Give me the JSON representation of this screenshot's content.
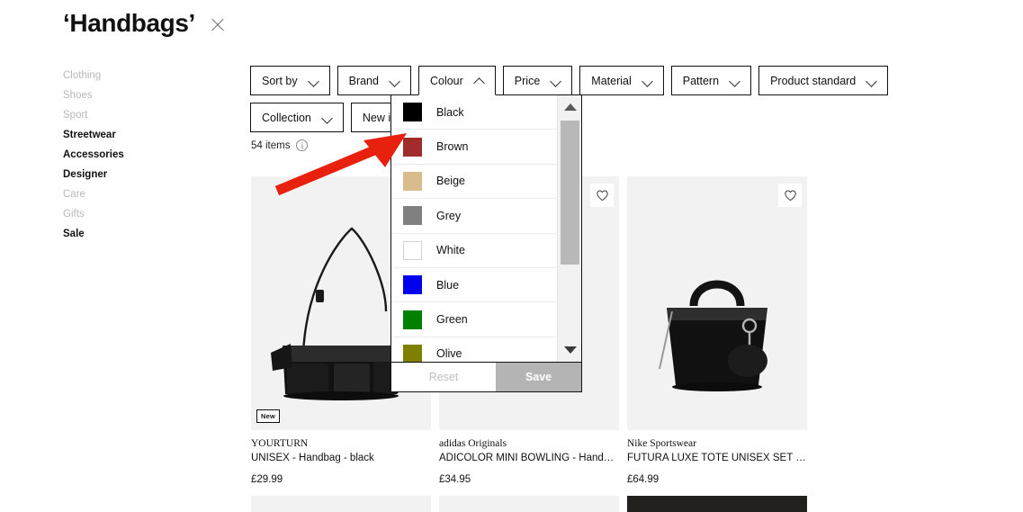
{
  "header": {
    "title": "‘Handbags’",
    "close_label": "close"
  },
  "sidebar": {
    "items": [
      {
        "label": "Clothing",
        "state": "muted"
      },
      {
        "label": "Shoes",
        "state": "muted"
      },
      {
        "label": "Sport",
        "state": "muted"
      },
      {
        "label": "Streetwear",
        "state": "active"
      },
      {
        "label": "Accessories",
        "state": "active"
      },
      {
        "label": "Designer",
        "state": "active"
      },
      {
        "label": "Care",
        "state": "muted"
      },
      {
        "label": "Gifts",
        "state": "muted"
      },
      {
        "label": "Sale",
        "state": "active"
      }
    ]
  },
  "filters": {
    "row1": [
      {
        "label": "Sort by",
        "open": false
      },
      {
        "label": "Brand",
        "open": false
      },
      {
        "label": "Colour",
        "open": true
      },
      {
        "label": "Price",
        "open": false
      },
      {
        "label": "Material",
        "open": false
      },
      {
        "label": "Pattern",
        "open": false
      },
      {
        "label": "Product standard",
        "open": false
      }
    ],
    "row2": [
      {
        "label": "Collection",
        "open": false
      },
      {
        "label": "New in",
        "open": false
      }
    ]
  },
  "results": {
    "count_text": "54 items",
    "info_icon": "info-icon",
    "info_glyph": "i"
  },
  "colour_dropdown": {
    "options": [
      {
        "label": "Black",
        "swatch": "#000000",
        "bordered": false
      },
      {
        "label": "Brown",
        "swatch": "#a02c2c",
        "bordered": false
      },
      {
        "label": "Beige",
        "swatch": "#d9bc8c",
        "bordered": false
      },
      {
        "label": "Grey",
        "swatch": "#808080",
        "bordered": false
      },
      {
        "label": "White",
        "swatch": "#ffffff",
        "bordered": true
      },
      {
        "label": "Blue",
        "swatch": "#0000ee",
        "bordered": false
      },
      {
        "label": "Green",
        "swatch": "#008000",
        "bordered": false
      },
      {
        "label": "Olive",
        "swatch": "#808000",
        "bordered": false
      }
    ],
    "reset_label": "Reset",
    "save_label": "Save",
    "scroll_up_icon": "scroll-up-arrow-icon",
    "scroll_down_icon": "scroll-down-arrow-icon"
  },
  "products": [
    {
      "brand": "YOURTURN",
      "name": "UNISEX - Handbag - black",
      "price": "£29.99",
      "badge": "New",
      "wishlist_icon": "heart-outline-icon"
    },
    {
      "brand": "adidas Originals",
      "name": "ADICOLOR MINI BOWLING - Handbag - b…",
      "price": "£34.95",
      "badge": "",
      "wishlist_icon": "heart-outline-icon"
    },
    {
      "brand": "Nike Sportswear",
      "name": "FUTURA LUXE TOTE UNISEX SET - Hand…",
      "price": "£64.99",
      "badge": "",
      "wishlist_icon": "heart-outline-icon"
    }
  ],
  "annotation": {
    "arrow_color": "#e8210f",
    "arrow_name": "red-pointer-arrow"
  }
}
